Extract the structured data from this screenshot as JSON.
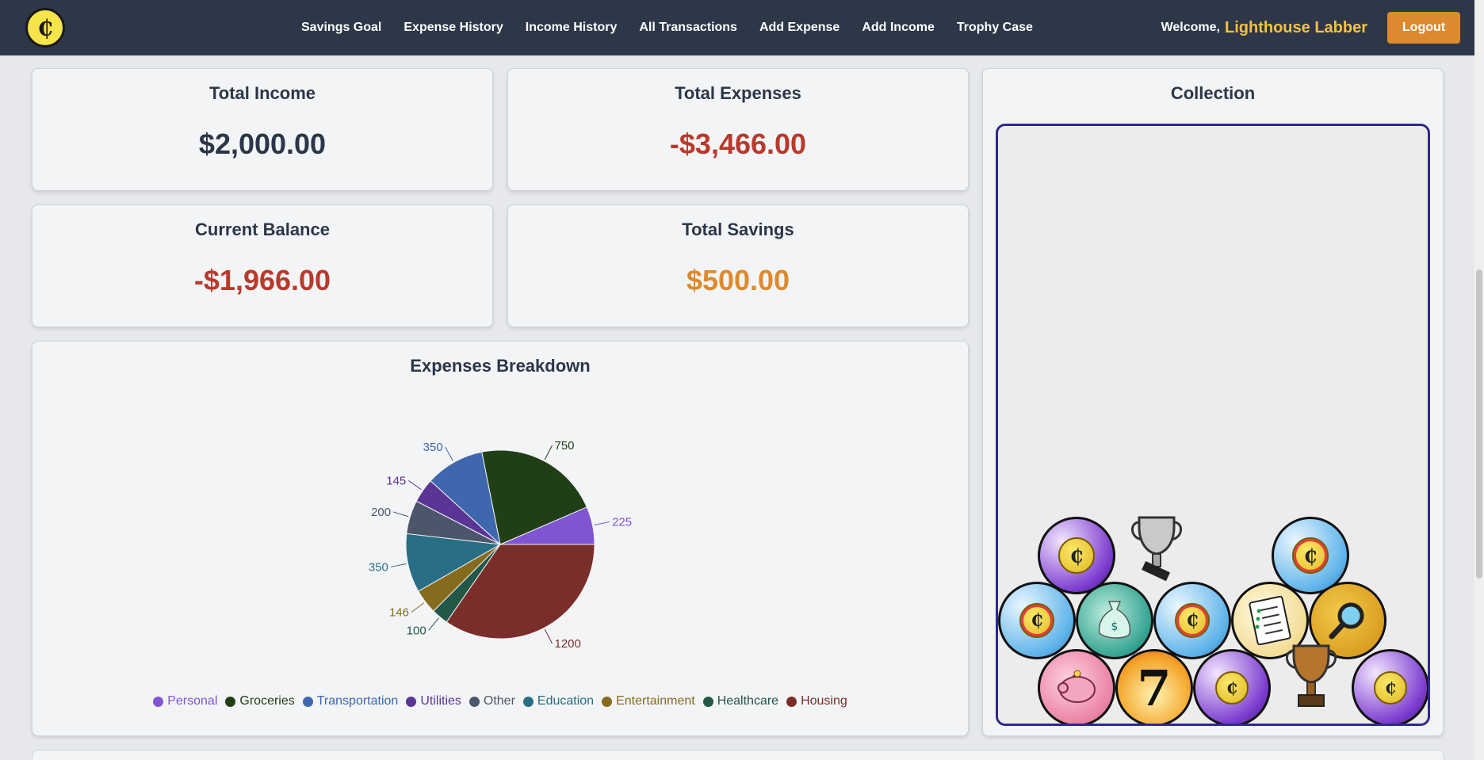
{
  "nav": {
    "logo_glyph": "₵",
    "links": [
      "Savings Goal",
      "Expense History",
      "Income History",
      "All Transactions",
      "Add Expense",
      "Add Income",
      "Trophy Case"
    ],
    "welcome_label": "Welcome,",
    "user_name": "Lighthouse Labber",
    "logout_label": "Logout"
  },
  "summary": {
    "total_income": {
      "title": "Total Income",
      "value": "$2,000.00",
      "color": "#2c3648"
    },
    "total_expenses": {
      "title": "Total Expenses",
      "value": "-$3,466.00",
      "color": "#b83a2b"
    },
    "current_balance": {
      "title": "Current Balance",
      "value": "-$1,966.00",
      "color": "#b83a2b"
    },
    "total_savings": {
      "title": "Total Savings",
      "value": "$500.00",
      "color": "#dd8a2e"
    }
  },
  "collection": {
    "title": "Collection"
  },
  "chart_data": {
    "type": "pie",
    "title": "Expenses Breakdown",
    "categories": [
      "Personal",
      "Groceries",
      "Transportation",
      "Utilities",
      "Other",
      "Education",
      "Entertainment",
      "Healthcare",
      "Housing"
    ],
    "values": [
      225,
      750,
      350,
      145,
      200,
      350,
      146,
      100,
      1200
    ],
    "colors": [
      "#8055d4",
      "#213f16",
      "#3f67ad",
      "#5b3595",
      "#4b566a",
      "#286e84",
      "#866b1f",
      "#235748",
      "#7a2e2a"
    ],
    "legend_position": "bottom"
  }
}
